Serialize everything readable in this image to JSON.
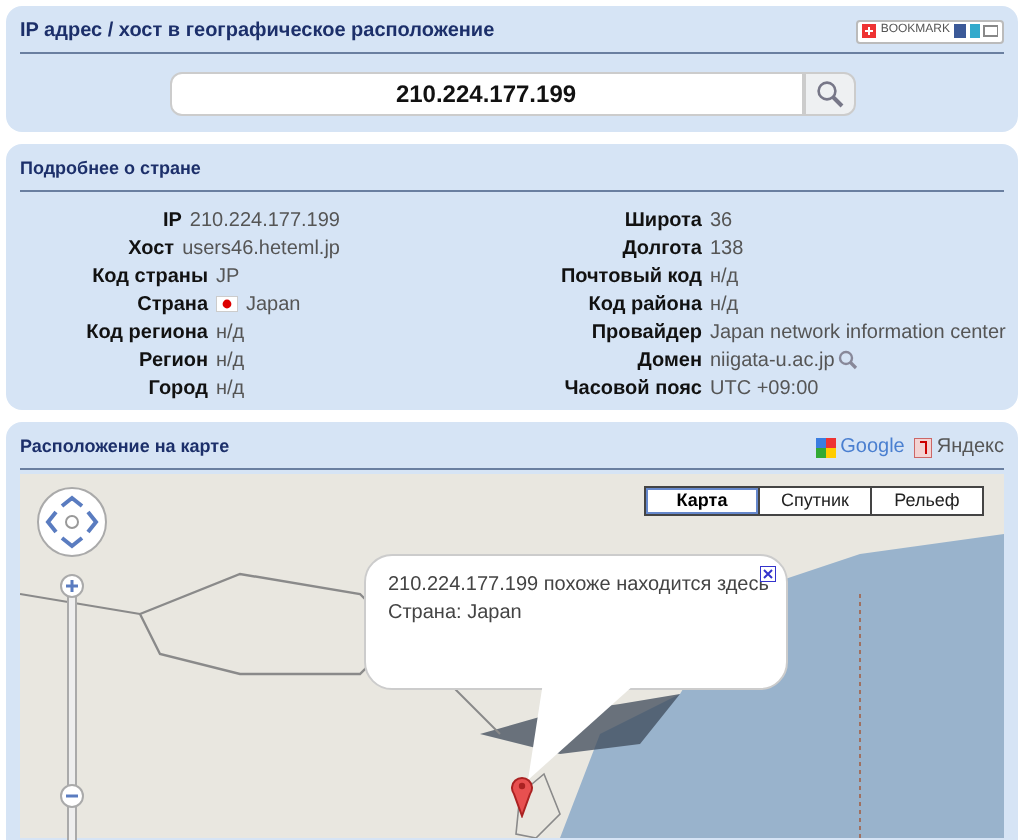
{
  "search_panel": {
    "title": "IP адрес / хост в географическое расположение",
    "bookmark": "BOOKMARK",
    "query": "210.224.177.199"
  },
  "details": {
    "title": "Подробнее о стране",
    "left": [
      {
        "label": "IP",
        "value": "210.224.177.199",
        "kind": "text"
      },
      {
        "label": "Хост",
        "value": "users46.heteml.jp",
        "kind": "text"
      },
      {
        "label": "Код страны",
        "value": "JP",
        "kind": "text"
      },
      {
        "label": "Страна",
        "value": "Japan",
        "kind": "flag"
      },
      {
        "label": "Код региона",
        "value": "н/д",
        "kind": "text"
      },
      {
        "label": "Регион",
        "value": "н/д",
        "kind": "text"
      },
      {
        "label": "Город",
        "value": "н/д",
        "kind": "text"
      }
    ],
    "right": [
      {
        "label": "Широта",
        "value": "36",
        "kind": "text"
      },
      {
        "label": "Долгота",
        "value": "138",
        "kind": "text"
      },
      {
        "label": "Почтовый код",
        "value": "н/д",
        "kind": "text"
      },
      {
        "label": "Код района",
        "value": "н/д",
        "kind": "text"
      },
      {
        "label": "Провайдер",
        "value": "Japan network information center",
        "kind": "text"
      },
      {
        "label": "Домен",
        "value": "niigata-u.ac.jp",
        "kind": "lookup"
      },
      {
        "label": "Часовой пояс",
        "value": "UTC +09:00",
        "kind": "text"
      }
    ]
  },
  "map": {
    "title": "Расположение на карте",
    "links": [
      {
        "label": "Google",
        "kind": "google"
      },
      {
        "label": "Яндекс",
        "kind": "yandex"
      }
    ],
    "map_types": [
      {
        "label": "Карта",
        "selected": true
      },
      {
        "label": "Спутник",
        "selected": false
      },
      {
        "label": "Рельеф",
        "selected": false
      }
    ],
    "popup": {
      "lines": [
        "210.224.177.199 похоже находится здесь",
        "Страна: Japan"
      ]
    }
  }
}
